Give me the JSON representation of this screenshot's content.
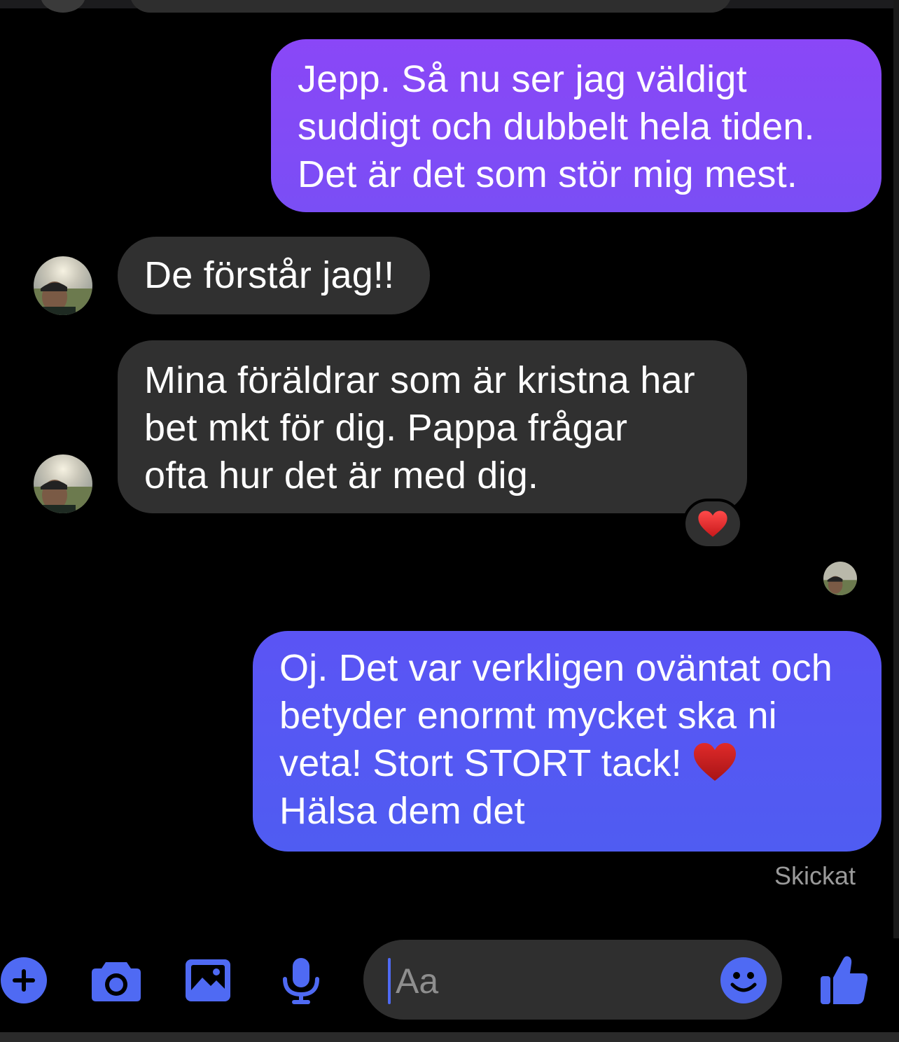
{
  "conversation": {
    "messages": [
      {
        "direction": "sent",
        "text": "Jepp. Så nu ser jag väldigt\nsuddigt och dubbelt hela tiden.\nDet är det som stör mig mest."
      },
      {
        "direction": "received",
        "text": "De förstår jag!!"
      },
      {
        "direction": "received",
        "text": "Mina föräldrar som är kristna har\nbet mkt för dig. Pappa frågar\nofta hur det är med dig.",
        "reaction": "heart-emoji"
      },
      {
        "direction": "sent",
        "text_before_emoji": "Oj. Det var verkligen oväntat och\nbetyder enormt mycket ska ni\nveta! Stort STORT tack! ",
        "emoji": "heart-emoji",
        "text_after_emoji": "\nHälsa dem det"
      }
    ],
    "status": "Skickat"
  },
  "composer": {
    "placeholder": "Aa",
    "accent_color": "#4f6af3",
    "icons": [
      "plus-icon",
      "camera-icon",
      "image-icon",
      "microphone-icon",
      "emoji-icon",
      "thumbs-up-icon"
    ]
  },
  "colors": {
    "sent_bubble_top": "#8a47f7",
    "sent_bubble_bottom": "#4f5cf2",
    "received_bubble": "#303030",
    "heart": "#c8191b"
  }
}
